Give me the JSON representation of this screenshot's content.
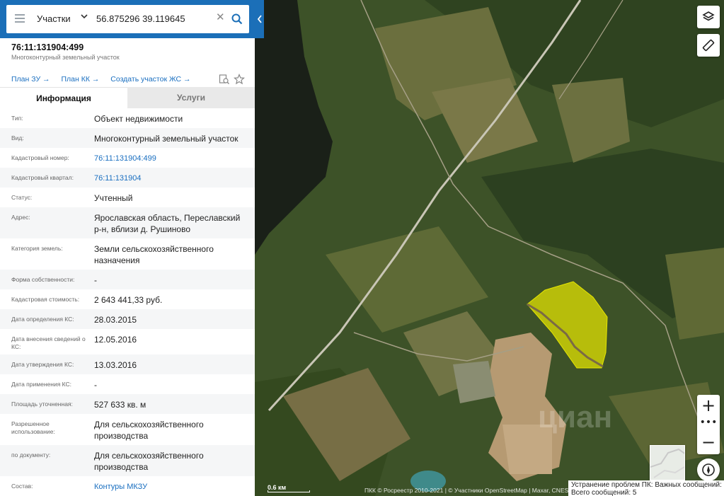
{
  "search": {
    "category": "Участки",
    "query": "56.875296 39.119645"
  },
  "parcel": {
    "title": "76:11:131904:499",
    "subtitle": "Многоконтурный земельный участок"
  },
  "links": [
    "План ЗУ →",
    "План КК →",
    "Создать участок ЖС →"
  ],
  "tabs": {
    "info": "Информация",
    "services": "Услуги"
  },
  "rows": [
    {
      "label": "Тип:",
      "value": "Объект недвижимости",
      "link": false
    },
    {
      "label": "Вид:",
      "value": "Многоконтурный земельный участок",
      "link": false
    },
    {
      "label": "Кадастровый номер:",
      "value": "76:11:131904:499",
      "link": true
    },
    {
      "label": "Кадастровый квартал:",
      "value": "76:11:131904",
      "link": true
    },
    {
      "label": "Статус:",
      "value": "Учтенный",
      "link": false
    },
    {
      "label": "Адрес:",
      "value": "Ярославская область, Переславский р-н, вблизи д. Рушиново",
      "link": false
    },
    {
      "label": "Категория земель:",
      "value": "Земли сельскохозяйственного назначения",
      "link": false
    },
    {
      "label": "Форма собственности:",
      "value": "-",
      "link": false
    },
    {
      "label": "Кадастровая стоимость:",
      "value": "2 643 441,33 руб.",
      "link": false
    },
    {
      "label": "Дата определения КС:",
      "value": "28.03.2015",
      "link": false
    },
    {
      "label": "Дата внесения сведений о КС:",
      "value": "12.05.2016",
      "link": false
    },
    {
      "label": "Дата утверждения КС:",
      "value": "13.03.2016",
      "link": false
    },
    {
      "label": "Дата применения КС:",
      "value": "-",
      "link": false
    },
    {
      "label": "Площадь уточненная:",
      "value": "527 633 кв. м",
      "link": false
    },
    {
      "label": "Разрешенное использование:",
      "value": "Для сельскохозяйственного производства",
      "link": false
    },
    {
      "label": "по документу:",
      "value": "Для сельскохозяйственного производства",
      "link": false
    },
    {
      "label": "Состав:",
      "value": "Контуры МКЗУ",
      "link": true
    }
  ],
  "map": {
    "scale_label": "0.6 км",
    "attribution": "ПКК © Росреестр 2010-2021 | © Участники OpenStreetMap | Maxar, CNES",
    "watermark": "циан",
    "problems_line1": "Устранение проблем ПК: Важных сообщений: 2",
    "problems_line2": "Всего сообщений: 5",
    "parcel_color": "#e6e600"
  },
  "icons": [
    "menu-icon",
    "chevron-down-icon",
    "close-icon",
    "search-icon",
    "collapse-arrow-icon",
    "edit-search-icon",
    "star-icon",
    "layers-icon",
    "ruler-icon",
    "zoom-in-icon",
    "more-icon",
    "zoom-out-icon",
    "compass-icon"
  ]
}
